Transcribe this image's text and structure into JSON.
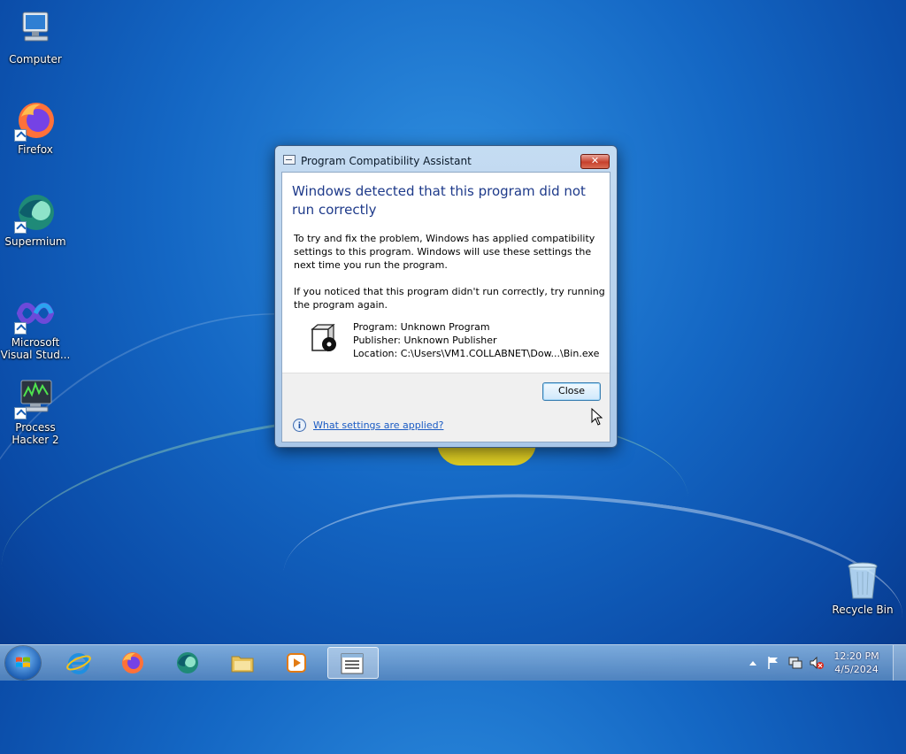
{
  "desktop": {
    "icons": [
      {
        "label": "Computer"
      },
      {
        "label": "Firefox"
      },
      {
        "label": "Supermium"
      },
      {
        "label": "Microsoft Visual Stud..."
      },
      {
        "label": "Process Hacker 2"
      },
      {
        "label": "Recycle Bin"
      }
    ]
  },
  "dialog": {
    "title": "Program Compatibility Assistant",
    "close_glyph": "✕",
    "heading": "Windows detected that this program did not run correctly",
    "paragraph1": "To try and fix the problem, Windows has applied compatibility settings to this program.  Windows will use these settings the next time you run the program.",
    "paragraph2": "If you noticed that this program didn't run correctly, try running the program again.",
    "program": "Program: Unknown Program",
    "publisher": "Publisher: Unknown Publisher",
    "location": "Location: C:\\Users\\VM1.COLLABNET\\Dow...\\Bin.exe",
    "close_button": "Close",
    "info_glyph": "i",
    "link": "What settings are applied?"
  },
  "taskbar": {
    "items": [
      "internet-explorer",
      "firefox",
      "supermium",
      "windows-explorer",
      "media-player",
      "open-app"
    ],
    "time": "12:20 PM",
    "date": "4/5/2024"
  },
  "colors": {
    "heading": "#1e3a8a",
    "link": "#1a5bc4",
    "desktop": "#1467c4"
  }
}
